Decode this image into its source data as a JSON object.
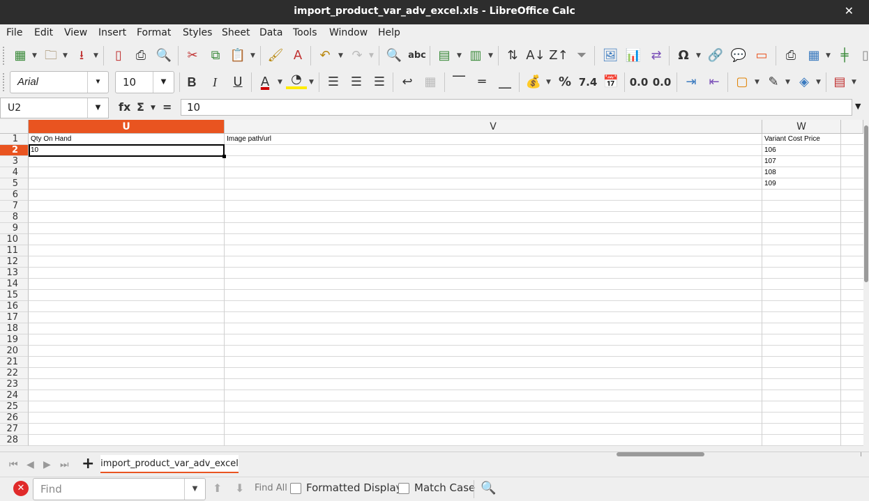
{
  "window": {
    "title": "import_product_var_adv_excel.xls - LibreOffice Calc"
  },
  "menu": [
    "File",
    "Edit",
    "View",
    "Insert",
    "Format",
    "Styles",
    "Sheet",
    "Data",
    "Tools",
    "Window",
    "Help"
  ],
  "toolbar2": {
    "font_name": "Arial",
    "font_size": "10"
  },
  "formula": {
    "cell_ref": "U2",
    "fx": "fx",
    "sum": "Σ",
    "equals": "=",
    "content": "10"
  },
  "columns": [
    {
      "label": "U",
      "selected": true
    },
    {
      "label": "V",
      "selected": false
    },
    {
      "label": "W",
      "selected": false
    }
  ],
  "rows": [
    "1",
    "2",
    "3",
    "4",
    "5",
    "6",
    "7",
    "8",
    "9",
    "10",
    "11",
    "12",
    "13",
    "14",
    "15",
    "16",
    "17",
    "18",
    "19",
    "20",
    "21",
    "22",
    "23",
    "24",
    "25",
    "26",
    "27",
    "28"
  ],
  "selected_row": "2",
  "cells": {
    "U1": "Qty On Hand",
    "V1": "Image path/url",
    "W1": "Variant Cost Price",
    "U2": "10",
    "W2": "106",
    "W3": "107",
    "W4": "108",
    "W5": "109"
  },
  "sheet_tab": "import_product_var_adv_excel",
  "findbar": {
    "placeholder": "Find",
    "find_all": "Find All",
    "formatted_display": "Formatted Display",
    "match_case": "Match Case"
  },
  "colors": {
    "accent": "#e95420",
    "titlebar": "#2d2d2d"
  }
}
